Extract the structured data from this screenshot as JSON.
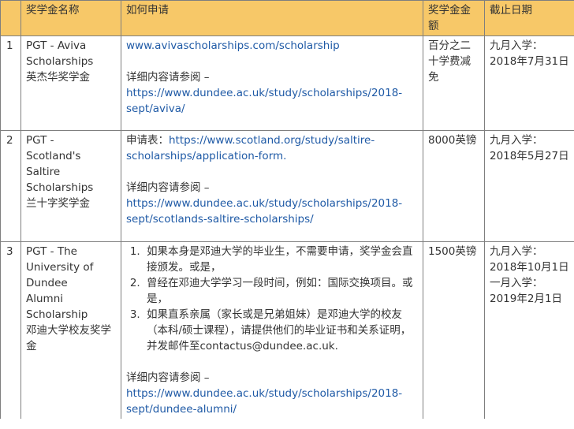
{
  "headers": [
    "",
    "奖学金名称",
    "如何申请",
    "奖学金金额",
    "截止日期"
  ],
  "rows": [
    {
      "index": "1",
      "name": [
        "PGT - Aviva",
        "Scholarships",
        "英杰华奖学金"
      ],
      "apply_link": "www.avivascholarships.com/scholarship",
      "details_label": "详细内容请参阅 –",
      "details_url": "https://www.dundee.ac.uk/study/scholarships/2018-sept/aviva/",
      "amount": "百分之二十学费减免",
      "deadline": [
        "九月入学：",
        "2018年7月31日"
      ]
    },
    {
      "index": "2",
      "name": [
        "PGT -",
        "Scotland's",
        "Saltire",
        "Scholarships",
        "兰十字奖学金"
      ],
      "apply_prefix": "申请表：",
      "apply_link": "https://www.scotland.org/study/saltire-scholarships/application-form.",
      "details_label": "详细内容请参阅 –",
      "details_url": "https://www.dundee.ac.uk/study/scholarships/2018-sept/scotlands-saltire-scholarships/",
      "amount": "8000英镑",
      "deadline": [
        "九月入学：",
        "2018年5月27日"
      ]
    },
    {
      "index": "3",
      "name": [
        "PGT - The",
        "University of",
        "Dundee",
        "Alumni",
        "Scholarship",
        "邓迪大学校友奖学金"
      ],
      "apply_items": [
        "如果本身是邓迪大学的毕业生，不需要申请，奖学金会直接颁发。或是，",
        "曾经在邓迪大学学习一段时间，例如：国际交换项目。或是，",
        "如果直系亲属（家长或是兄弟姐妹）是邓迪大学的校友（本科/硕士课程），请提供他们的毕业证书和关系证明，并发邮件至contactus@dundee.ac.uk."
      ],
      "details_label": "详细内容请参阅 –",
      "details_url": "https://www.dundee.ac.uk/study/scholarships/2018-sept/dundee-alumni/",
      "amount": "1500英镑",
      "deadline": [
        "九月入学：",
        "2018年10月1日",
        "一月入学：",
        "2019年2月1日"
      ]
    }
  ]
}
